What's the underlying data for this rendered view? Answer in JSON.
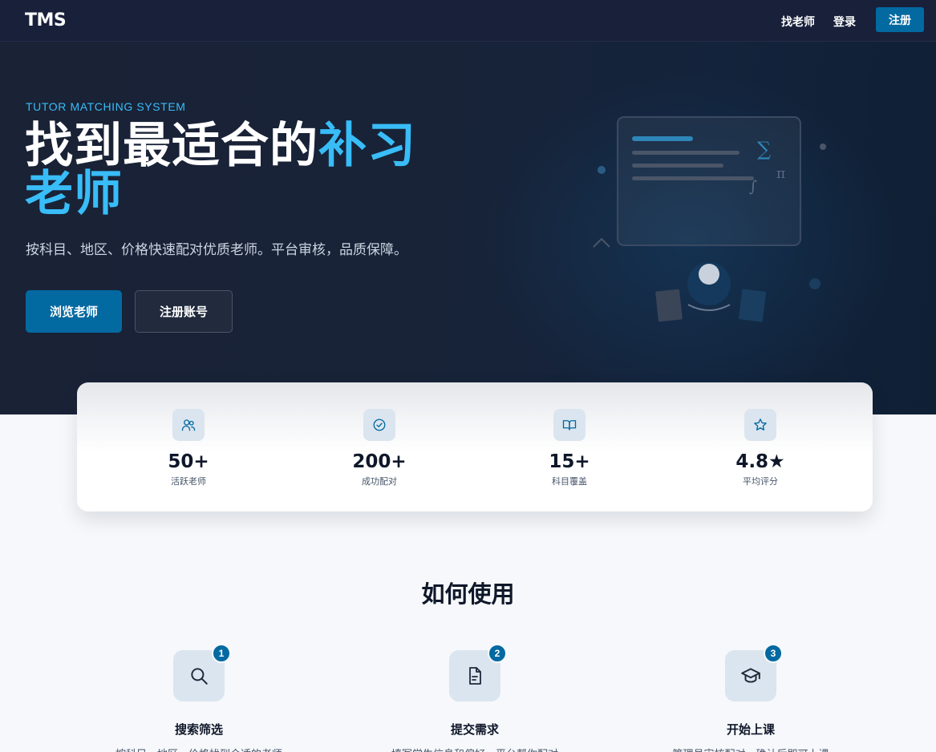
{
  "nav": {
    "logo": "TMS",
    "find_teacher": "找老师",
    "login": "登录",
    "register": "注册"
  },
  "hero": {
    "eyebrow": "TUTOR MATCHING SYSTEM",
    "title_part1": "找到最适合的",
    "title_accent": "补习",
    "title_part2": "老师",
    "subtitle": "按科目、地区、价格快速配对优质老师。平台审核，品质保障。",
    "primary_button": "浏览老师",
    "secondary_button": "注册账号"
  },
  "stats": [
    {
      "icon": "users-icon",
      "value": "50+",
      "label": "活跃老师"
    },
    {
      "icon": "check-circle-icon",
      "value": "200+",
      "label": "成功配对"
    },
    {
      "icon": "book-open-icon",
      "value": "15+",
      "label": "科目覆盖"
    },
    {
      "icon": "star-icon",
      "value": "4.8★",
      "label": "平均评分"
    }
  ],
  "how": {
    "title": "如何使用",
    "steps": [
      {
        "number": "1",
        "icon": "search-icon",
        "title": "搜索筛选",
        "desc": "按科目、地区、价格找到合适的老师"
      },
      {
        "number": "2",
        "icon": "document-icon",
        "title": "提交需求",
        "desc": "填写学生信息和偏好，平台帮你配对"
      },
      {
        "number": "3",
        "icon": "graduation-cap-icon",
        "title": "开始上课",
        "desc": "管理员审核配对，确认后即可上课"
      }
    ]
  },
  "colors": {
    "nav_bg": "#18203a",
    "accent": "#38bdf8",
    "primary": "#0369a1",
    "text_dark": "#0f172a"
  }
}
